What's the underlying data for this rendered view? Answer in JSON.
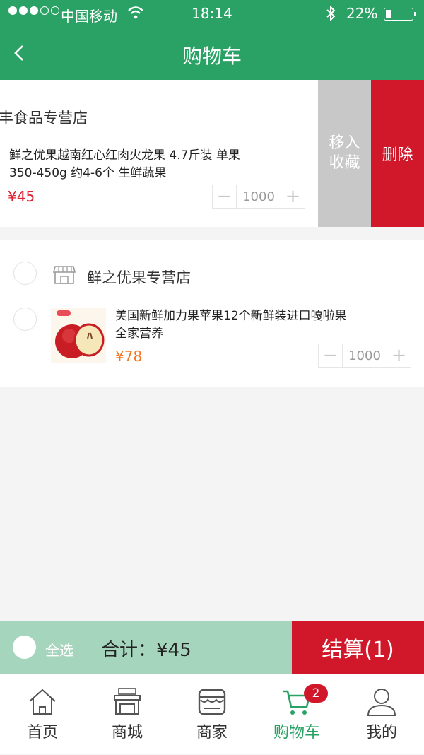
{
  "status": {
    "carrier": "中国移动",
    "time": "18:14",
    "battery": "22%",
    "battery_level": 0.22
  },
  "nav": {
    "title": "购物车",
    "back_icon": "chevron-left-icon"
  },
  "cart": {
    "stores": [
      {
        "name": "丰食品专营店",
        "items": [
          {
            "name": "鲜之优果越南红心红肉火龙果 4.7斤装 单果350-450g 约4-6个 生鲜蔬果",
            "price": "¥45",
            "qty": "1000"
          }
        ],
        "swipe_actions": {
          "favorite": "移入\n收藏",
          "delete": "删除"
        }
      },
      {
        "name": "鲜之优果专营店",
        "items": [
          {
            "name": "美国新鲜加力果苹果12个新鲜装进口嘎啦果全家营养",
            "price": "¥78",
            "qty": "1000"
          }
        ]
      }
    ]
  },
  "checkout": {
    "select_all": "全选",
    "total": "合计：¥45",
    "button": "结算(1)"
  },
  "tabs": [
    {
      "label": "首页",
      "icon": "home-icon"
    },
    {
      "label": "商城",
      "icon": "mall-icon"
    },
    {
      "label": "商家",
      "icon": "store-icon"
    },
    {
      "label": "购物车",
      "icon": "cart-icon",
      "badge": "2",
      "active": true
    },
    {
      "label": "我的",
      "icon": "user-icon"
    }
  ],
  "colors": {
    "brand_green": "#2aa165",
    "red": "#d0182a",
    "price_red": "#e0202e",
    "price_orange": "#f5761e"
  }
}
